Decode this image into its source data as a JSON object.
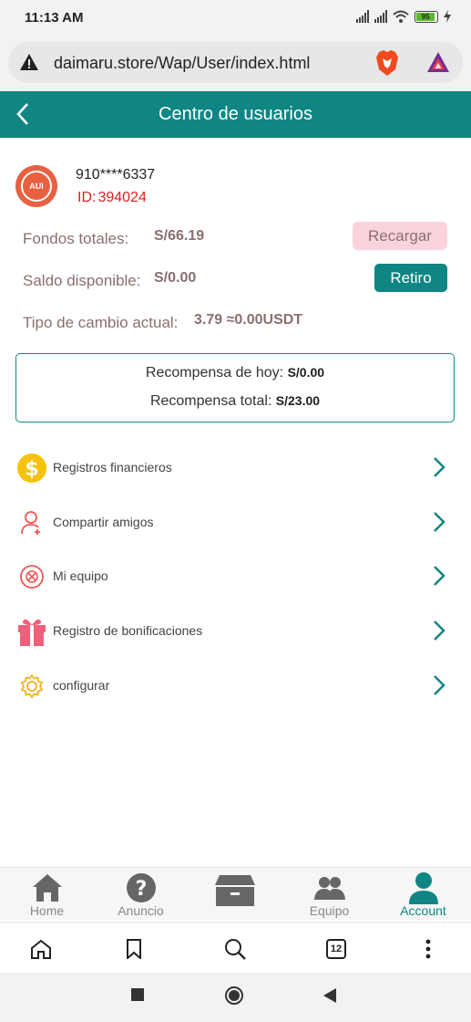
{
  "status_bar": {
    "time": "11:13 AM",
    "battery": "95"
  },
  "browser": {
    "url": "daimaru.store/Wap/User/index.html",
    "tab_count": "12"
  },
  "header": {
    "title": "Centro de usuarios"
  },
  "profile": {
    "avatar_text": "AUI",
    "phone": "910****6337",
    "id_label": "ID:",
    "id_value": "394024"
  },
  "funds": {
    "total_label": "Fondos totales:",
    "total_value": "S/66.19",
    "available_label": "Saldo disponible:",
    "available_value": "S/0.00",
    "rate_label": "Tipo de cambio actual:",
    "rate_value": "3.79 ≈0.00USDT",
    "recharge_button": "Recargar",
    "withdraw_button": "Retiro"
  },
  "rewards": {
    "today_label": "Recompensa de hoy:",
    "today_value": "S/0.00",
    "total_label": "Recompensa total:",
    "total_value": "S/23.00"
  },
  "menu": [
    {
      "label": "Registros financieros",
      "icon": "dollar-coin-icon"
    },
    {
      "label": "Compartir amigos",
      "icon": "person-add-icon"
    },
    {
      "label": "Mi equipo",
      "icon": "team-target-icon"
    },
    {
      "label": "Registro de bonificaciones",
      "icon": "gift-icon"
    },
    {
      "label": "configurar",
      "icon": "gear-icon"
    }
  ],
  "app_nav": [
    {
      "label": "Home",
      "icon": "home-icon"
    },
    {
      "label": "Anuncio",
      "icon": "question-icon"
    },
    {
      "label": "",
      "icon": "box-icon"
    },
    {
      "label": "Equipo",
      "icon": "group-icon"
    },
    {
      "label": "Account",
      "icon": "person-icon",
      "active": true
    }
  ],
  "colors": {
    "primary": "#0f8684",
    "recharge_bg": "#fbd3dc",
    "id_red": "#e02020",
    "label_brown": "#8a6f6f"
  }
}
